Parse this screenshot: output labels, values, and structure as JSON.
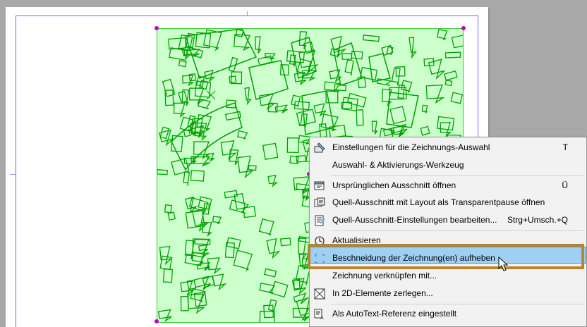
{
  "menu": {
    "items": [
      {
        "label": "Einstellungen für die Zeichnungs-Auswahl",
        "shortcut": "T",
        "icon": "drawing-settings-icon"
      },
      {
        "label": "Auswahl- & Aktivierungs-Werkzeug",
        "shortcut": "",
        "icon": ""
      },
      {
        "label": "Ursprünglichen Ausschnitt öffnen",
        "shortcut": "Ü",
        "icon": "open-view-icon"
      },
      {
        "label": "Quell-Ausschnitt mit Layout als Transparentpause öffnen",
        "shortcut": "",
        "icon": "trace-reference-icon"
      },
      {
        "label": "Quell-Ausschnitt-Einstellungen bearbeiten...",
        "shortcut": "Strg+Umsch.+Q",
        "icon": "view-settings-icon"
      },
      {
        "label": "Aktualisieren",
        "shortcut": "",
        "icon": "refresh-icon"
      },
      {
        "label": "Beschneidung der Zeichnung(en) aufheben",
        "shortcut": "",
        "icon": "unclip-icon"
      },
      {
        "label": "Zeichnung verknüpfen mit...",
        "shortcut": "",
        "icon": "link-icon"
      },
      {
        "label": "In 2D-Elemente zerlegen...",
        "shortcut": "",
        "icon": "explode-icon"
      },
      {
        "label": "Als AutoText-Referenz eingestellt",
        "shortcut": "",
        "icon": "autotext-icon"
      }
    ],
    "highlighted_index": 6
  },
  "colors": {
    "menu_bg": "#f2f2f2",
    "highlight": "#9fcff2",
    "focus_frame": "#b8862a",
    "drawing_fill": "#ccffcc",
    "drawing_lines": "#00aa00",
    "selection_handles": "#c000c0"
  }
}
